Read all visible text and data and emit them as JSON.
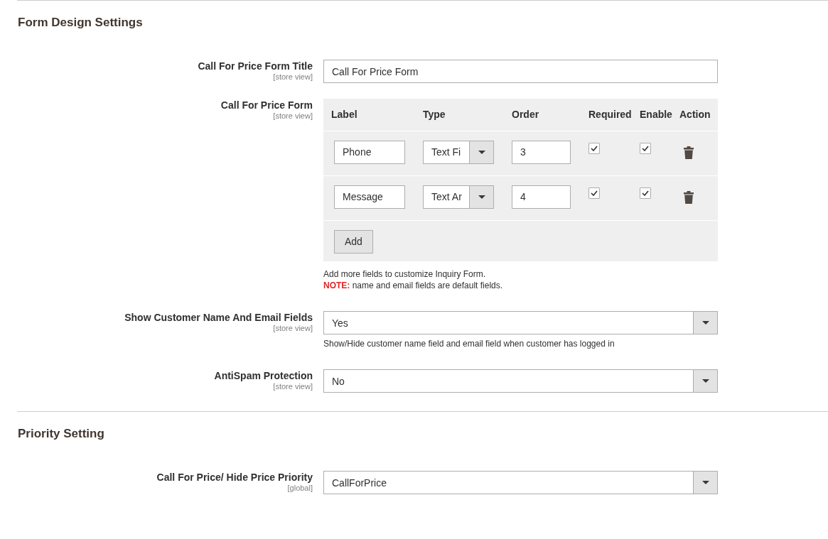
{
  "sections": [
    {
      "title": "Form Design Settings",
      "fields": [
        {
          "kind": "text",
          "label": "Call For Price Form Title",
          "scope": "[store view]",
          "value": "Call For Price Form"
        },
        {
          "kind": "grid",
          "label": "Call For Price Form",
          "scope": "[store view]",
          "columns": [
            "Label",
            "Type",
            "Order",
            "Required",
            "Enable",
            "Action"
          ],
          "rows": [
            {
              "label": "Phone",
              "type": "Text Fi",
              "order": "3",
              "required": true,
              "enable": true
            },
            {
              "label": "Message",
              "type": "Text Ar",
              "order": "4",
              "required": true,
              "enable": true
            }
          ],
          "add_button": "Add",
          "notes": [
            "Add more fields to customize Inquiry Form.",
            "**NOTE:** name and email fields are default fields."
          ]
        },
        {
          "kind": "select",
          "label": "Show Customer Name And Email Fields",
          "scope": "[store view]",
          "value": "Yes",
          "notes": [
            "Show/Hide customer name field and email field when customer has logged in"
          ]
        },
        {
          "kind": "select",
          "label": "AntiSpam Protection",
          "scope": "[store view]",
          "value": "No"
        }
      ]
    },
    {
      "title": "Priority Setting",
      "fields": [
        {
          "kind": "select",
          "label": "Call For Price/ Hide Price Priority",
          "scope": "[global]",
          "value": "CallForPrice"
        }
      ]
    }
  ]
}
